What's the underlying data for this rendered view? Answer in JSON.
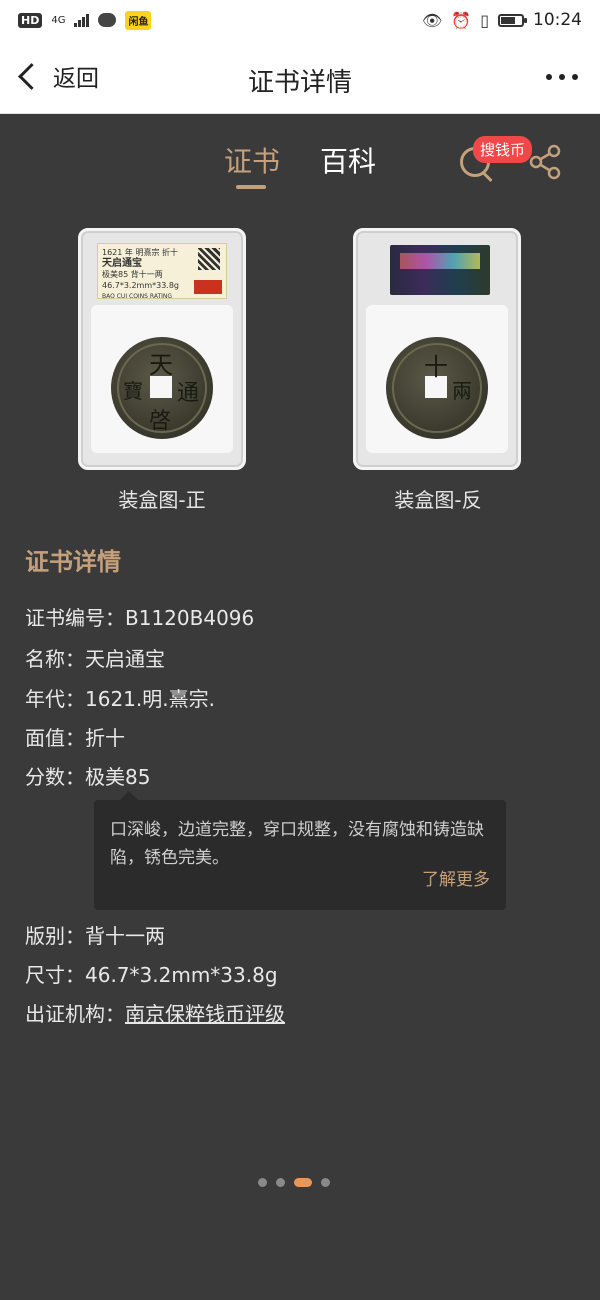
{
  "status_bar": {
    "hd": "HD",
    "net": "4G",
    "app_badge": "闲鱼",
    "time": "10:24",
    "battery_level": 0.7
  },
  "header": {
    "back_label": "返回",
    "title": "证书详情"
  },
  "tabs": [
    {
      "label": "证书",
      "active": true
    },
    {
      "label": "百科",
      "active": false
    }
  ],
  "search_badge": "搜钱币",
  "images": {
    "front_caption": "装盒图-正",
    "back_caption": "装盒图-反",
    "front_label": {
      "line1": "1621 年 明熹宗   折十",
      "line2": "天启通宝",
      "line3": "极美85  背十一两",
      "line4": "46.7*3.2mm*33.8g",
      "line5": "BAO CUI COINS RATING"
    },
    "coin_front_chars": [
      "天",
      "通",
      "啓",
      "寶"
    ],
    "coin_back_chars": [
      "十",
      "兩"
    ]
  },
  "details": {
    "section_title": "证书详情",
    "rows": [
      {
        "label": "证书编号：",
        "value": "B1120B4096"
      },
      {
        "label": "名称：",
        "value": "天启通宝"
      },
      {
        "label": "年代：",
        "value": "1621.明.熹宗."
      },
      {
        "label": "面值：",
        "value": "折十"
      },
      {
        "label": "分数：",
        "value": "极美85"
      }
    ],
    "tooltip": {
      "text": "口深峻，边道完整，穿口规整，没有腐蚀和铸造缺陷，锈色完美。",
      "link": "了解更多"
    },
    "rows2": [
      {
        "label": "版别：",
        "value": "背十一两"
      },
      {
        "label": "尺寸：",
        "value": "46.7*3.2mm*33.8g"
      },
      {
        "label": "出证机构：",
        "value": "南京保粹钱币评级"
      }
    ]
  },
  "pager": {
    "count": 4,
    "active_index": 2
  }
}
